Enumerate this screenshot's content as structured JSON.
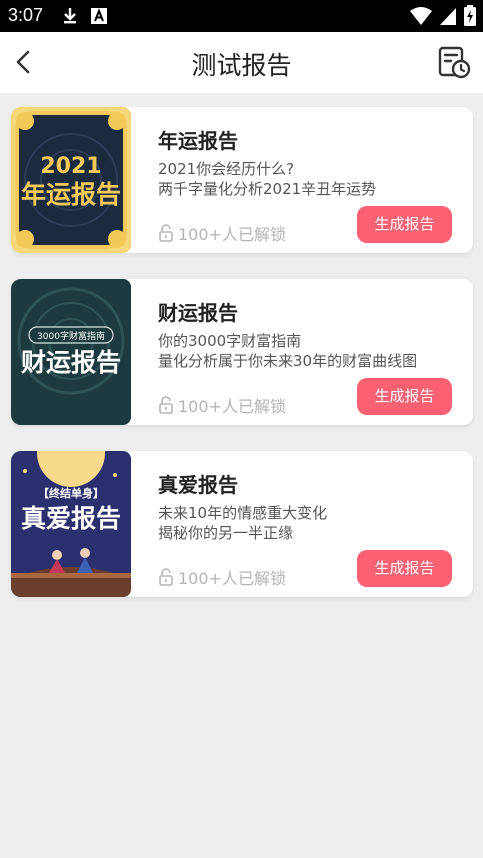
{
  "status_bar": {
    "time": "3:07",
    "icons": [
      "download-icon",
      "notification-a-icon",
      "wifi-icon",
      "signal-icon",
      "battery-charging-icon"
    ]
  },
  "header": {
    "title": "测试报告",
    "back_icon": "chevron-left-icon",
    "history_icon": "report-history-icon"
  },
  "reports": [
    {
      "name": "年运报告",
      "desc": [
        "2021你会经历什么?",
        "两千字量化分析2021辛丑年运势"
      ],
      "unlock_text": "100+人已解锁",
      "button": "生成报告",
      "thumb": {
        "line1": "2021",
        "line2": "年运报告"
      }
    },
    {
      "name": "财运报告",
      "desc": [
        "你的3000字财富指南",
        "量化分析属于你未来30年的财富曲线图"
      ],
      "unlock_text": "100+人已解锁",
      "button": "生成报告",
      "thumb": {
        "line1": "3000字财富指南",
        "line2": "财运报告"
      }
    },
    {
      "name": "真爱报告",
      "desc": [
        "未来10年的情感重大变化",
        "揭秘你的另一半正缘"
      ],
      "unlock_text": "100+人已解锁",
      "button": "生成报告",
      "thumb": {
        "line1": "【终结单身】",
        "line2": "真爱报告"
      }
    }
  ],
  "colors": {
    "accent_button": "#fb6073",
    "background": "#eeeeee",
    "thumb1_bg": "#1c2a3e",
    "thumb1_frame": "#f3c95a",
    "thumb2_bg": "#1d3b3f",
    "thumb3_bg": "#2b2f6e"
  }
}
